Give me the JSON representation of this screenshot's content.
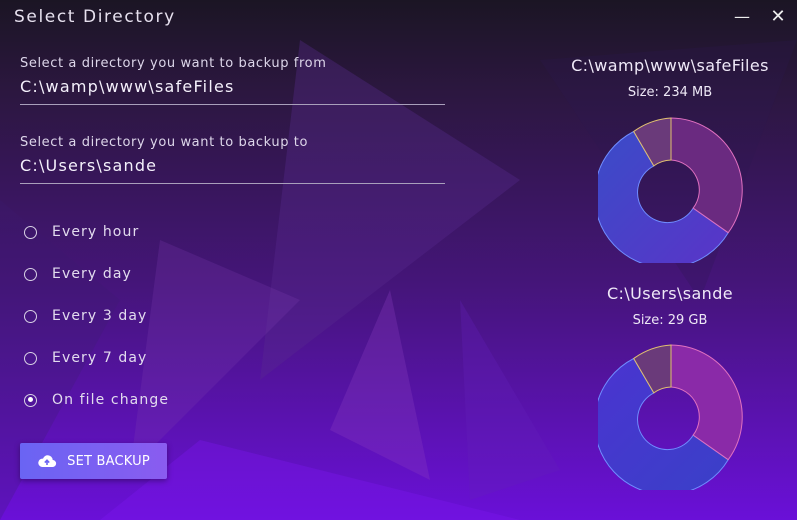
{
  "window": {
    "title": "Select Directory"
  },
  "source": {
    "label": "Select a directory you want to backup from",
    "value": "C:\\wamp\\www\\safeFiles"
  },
  "target": {
    "label": "Select a directory you want to backup to",
    "value": "C:\\Users\\sande"
  },
  "schedule": {
    "options": [
      {
        "label": "Every hour",
        "checked": false
      },
      {
        "label": "Every day",
        "checked": false
      },
      {
        "label": "Every 3 day",
        "checked": false
      },
      {
        "label": "Every 7 day",
        "checked": false
      },
      {
        "label": "On file change",
        "checked": true
      }
    ]
  },
  "set_backup": {
    "label": "SET BACKUP",
    "icon": "cloud-upload-icon"
  },
  "disks": [
    {
      "path": "C:\\wamp\\www\\safeFiles",
      "size": "Size: 234 MB"
    },
    {
      "path": "C:\\Users\\sande",
      "size": "Size: 29 GB"
    }
  ],
  "colors": {
    "accent": "#6a64f3",
    "donut_blue": "#4a3ccc",
    "donut_magenta": "#7d2a9c",
    "donut_gold": "#d6b56a"
  }
}
